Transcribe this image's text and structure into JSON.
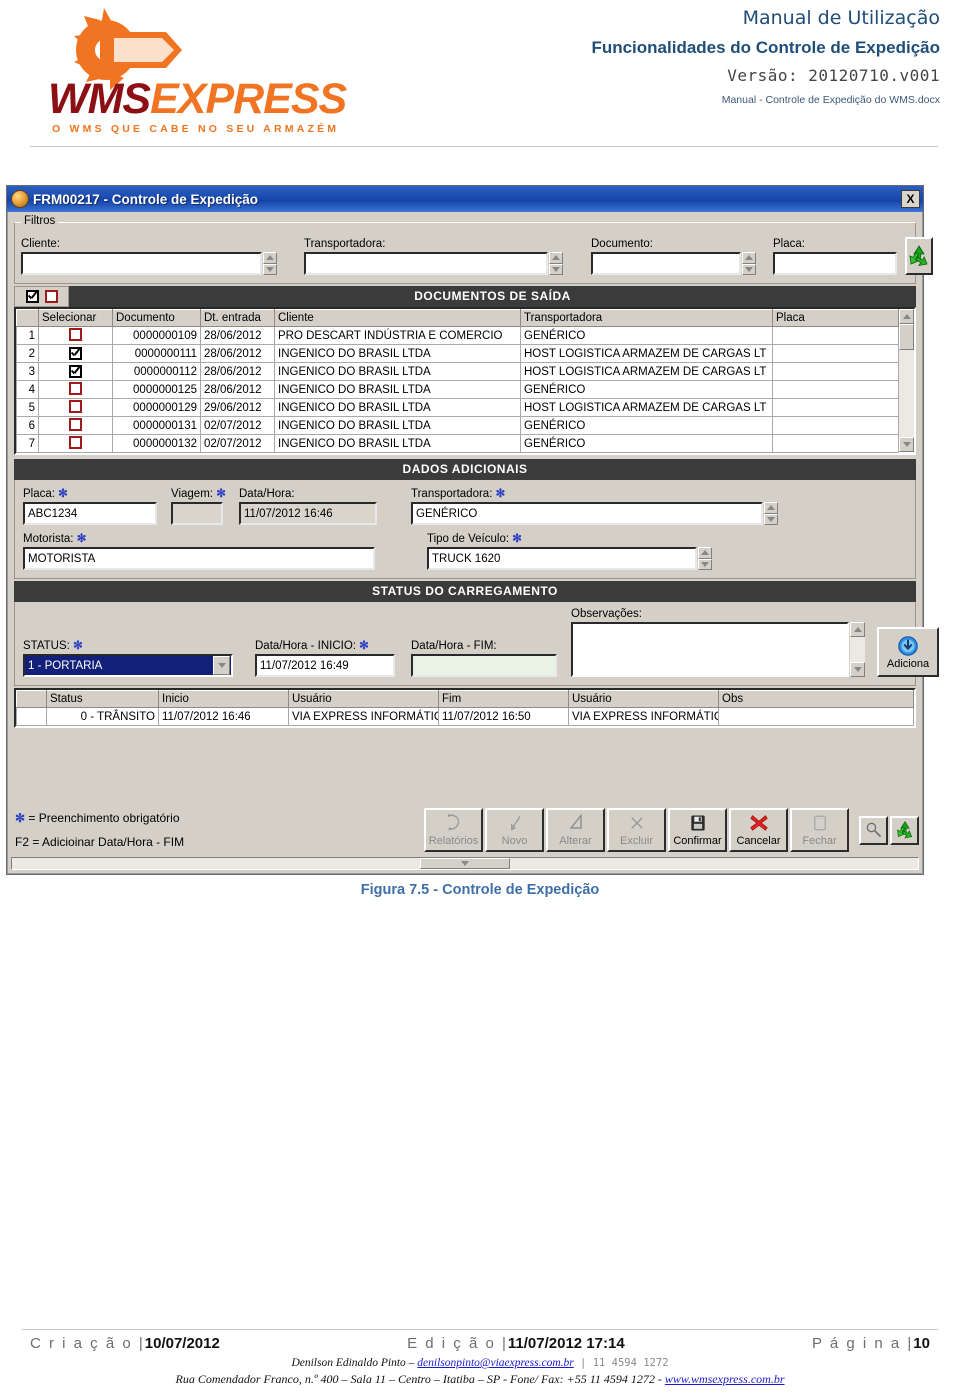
{
  "doc_header": {
    "logo_word_1": "WMS",
    "logo_word_2": "EXPRESS",
    "logo_tagline": "O WMS QUE CABE NO SEU ARMAZÉM",
    "line1": "Manual de Utilização",
    "line2": "Funcionalidades do Controle de Expedição",
    "line3": "Versão: 20120710.v001",
    "line4": "Manual - Controle de Expedição do WMS.docx",
    "brand_dark_red": "#8c0f13",
    "brand_orange": "#f07421",
    "heading_blue": "#1f4e79"
  },
  "window": {
    "title": "FRM00217 - Controle de Expedição",
    "close_label": "X",
    "filters": {
      "legend": "Filtros",
      "cliente_label": "Cliente:",
      "cliente_value": "",
      "transportadora_label": "Transportadora:",
      "transportadora_value": "",
      "documento_label": "Documento:",
      "documento_value": "",
      "placa_label": "Placa:",
      "placa_value": "",
      "refresh_icon": "refresh-recycle-icon"
    },
    "documents": {
      "section_title": "DOCUMENTOS DE SAÍDA",
      "select_all_checked": true,
      "clear_all_checked": false,
      "columns": [
        "",
        "Selecionar",
        "Documento",
        "Dt. entrada",
        "Cliente",
        "Transportadora",
        "Placa"
      ],
      "rows": [
        {
          "n": "1",
          "checked": false,
          "documento": "0000000109",
          "dt_entrada": "28/06/2012",
          "cliente": "PRO DESCART INDÚSTRIA E COMERCIO",
          "transportadora": "GENÉRICO",
          "placa": ""
        },
        {
          "n": "2",
          "checked": true,
          "documento": "0000000111",
          "dt_entrada": "28/06/2012",
          "cliente": "INGENICO DO BRASIL LTDA",
          "transportadora": "HOST LOGISTICA ARMAZEM DE CARGAS LT",
          "placa": ""
        },
        {
          "n": "3",
          "checked": true,
          "documento": "0000000112",
          "dt_entrada": "28/06/2012",
          "cliente": "INGENICO DO BRASIL LTDA",
          "transportadora": "HOST LOGISTICA ARMAZEM DE CARGAS LT",
          "placa": ""
        },
        {
          "n": "4",
          "checked": false,
          "documento": "0000000125",
          "dt_entrada": "28/06/2012",
          "cliente": "INGENICO DO BRASIL LTDA",
          "transportadora": "GENÉRICO",
          "placa": ""
        },
        {
          "n": "5",
          "checked": false,
          "documento": "0000000129",
          "dt_entrada": "29/06/2012",
          "cliente": "INGENICO DO BRASIL LTDA",
          "transportadora": "HOST LOGISTICA ARMAZEM DE CARGAS LT",
          "placa": ""
        },
        {
          "n": "6",
          "checked": false,
          "documento": "0000000131",
          "dt_entrada": "02/07/2012",
          "cliente": "INGENICO DO BRASIL LTDA",
          "transportadora": "GENÉRICO",
          "placa": ""
        },
        {
          "n": "7",
          "checked": false,
          "documento": "0000000132",
          "dt_entrada": "02/07/2012",
          "cliente": "INGENICO DO BRASIL LTDA",
          "transportadora": "GENÉRICO",
          "placa": ""
        }
      ]
    },
    "dados_adicionais": {
      "section_title": "DADOS ADICIONAIS",
      "placa_label": "Placa:",
      "placa_value": "ABC1234",
      "viagem_label": "Viagem:",
      "viagem_value": "",
      "datahora_label": "Data/Hora:",
      "datahora_value": "11/07/2012 16:46",
      "transportadora_label": "Transportadora:",
      "transportadora_value": "GENÉRICO",
      "motorista_label": "Motorista:",
      "motorista_value": "MOTORISTA",
      "tipo_veiculo_label": "Tipo de Veículo:",
      "tipo_veiculo_value": "TRUCK 1620"
    },
    "status_carregamento": {
      "section_title": "STATUS DO CARREGAMENTO",
      "status_label": "STATUS:",
      "status_value": "1 - PORTARIA",
      "inicio_label": "Data/Hora - INICIO:",
      "inicio_value": "11/07/2012 16:49",
      "fim_label": "Data/Hora - FIM:",
      "fim_value": "",
      "observacoes_label": "Observações:",
      "observacoes_value": "",
      "add_button_label": "Adiciona",
      "add_button_icon": "download-arrow-icon",
      "history_columns": [
        "",
        "Status",
        "Inicio",
        "Usuário",
        "Fim",
        "Usuário",
        "Obs"
      ],
      "history_rows": [
        {
          "status": "0 - TRÂNSITO",
          "inicio": "11/07/2012 16:46",
          "usuario1": "VIA EXPRESS INFORMÁTICA",
          "fim": "11/07/2012 16:50",
          "usuario2": "VIA EXPRESS INFORMÁTICA",
          "obs": ""
        }
      ]
    },
    "footer_hints": {
      "hint1": "= Preenchimento obrigatório",
      "hint1_marker": "✻",
      "hint2": "F2 = Adicioinar Data/Hora - FIM"
    },
    "toolbar": {
      "buttons": [
        {
          "label": "Relatórios",
          "icon": "report-icon",
          "accel": "ó",
          "disabled": true
        },
        {
          "label": "Novo",
          "icon": "new-icon",
          "accel": "N",
          "disabled": true
        },
        {
          "label": "Alterar",
          "icon": "edit-pencil-icon",
          "accel": "A",
          "disabled": true
        },
        {
          "label": "Excluir",
          "icon": "delete-x-icon",
          "accel": "x",
          "disabled": true
        },
        {
          "label": "Confirmar",
          "icon": "save-floppy-icon",
          "accel": "fi",
          "disabled": false
        },
        {
          "label": "Cancelar",
          "icon": "cancel-red-x-icon",
          "accel": "C",
          "disabled": false
        },
        {
          "label": "Fechar",
          "icon": "close-door-icon",
          "accel": "F",
          "disabled": true
        }
      ],
      "search_icon": "magnifier-icon",
      "refresh_icon": "refresh-recycle-icon"
    }
  },
  "caption": "Figura 7.5 - Controle de Expedição",
  "footer": {
    "criacao_label": "C r i a ç ã o |",
    "criacao_value": "10/07/2012",
    "edicao_label": "E d i ç ã o |",
    "edicao_value": "11/07/2012 17:14",
    "pagina_label": "P á g i n a |",
    "pagina_value": "10",
    "contact_name": "Denilson Edinaldo Pinto – ",
    "contact_email": "denilsonpinto@viaexpress.com.br",
    "contact_sep": " | ",
    "contact_phone": "11 4594 1272",
    "address": "Rua Comendador Franco, n.º 400 – Sala 11 – Centro – Itatiba – SP - Fone/ Fax: +55 11 4594 1272 - ",
    "site": "www.wmsexpress.com.br"
  }
}
